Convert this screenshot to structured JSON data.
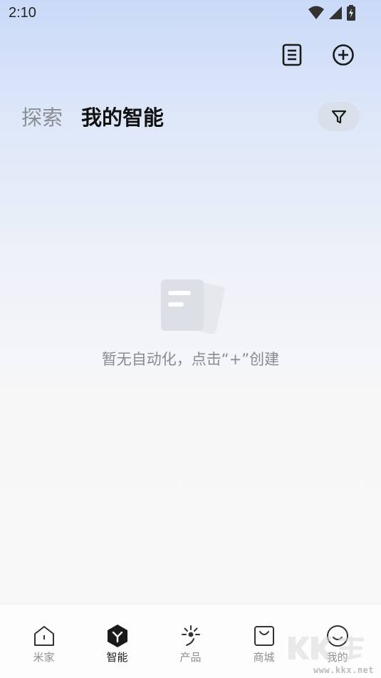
{
  "status_bar": {
    "time": "2:10"
  },
  "tabs": [
    {
      "label": "探索",
      "active": false
    },
    {
      "label": "我的智能",
      "active": true
    }
  ],
  "empty_state": {
    "message": "暂无自动化，点击“+”创建"
  },
  "bottom_nav": [
    {
      "label": "米家",
      "icon": "home-icon",
      "active": false
    },
    {
      "label": "智能",
      "icon": "smart-hexagon-icon",
      "active": true
    },
    {
      "label": "产品",
      "icon": "spark-icon",
      "active": false
    },
    {
      "label": "商城",
      "icon": "shopping-bag-icon",
      "active": false
    },
    {
      "label": "我的",
      "icon": "smiley-profile-icon",
      "active": false
    }
  ],
  "watermark": {
    "text": "www.kkx.net"
  },
  "colors": {
    "active_text": "#111111",
    "inactive_text": "#8a8d93",
    "filter_bg": "#d9e0ea"
  }
}
